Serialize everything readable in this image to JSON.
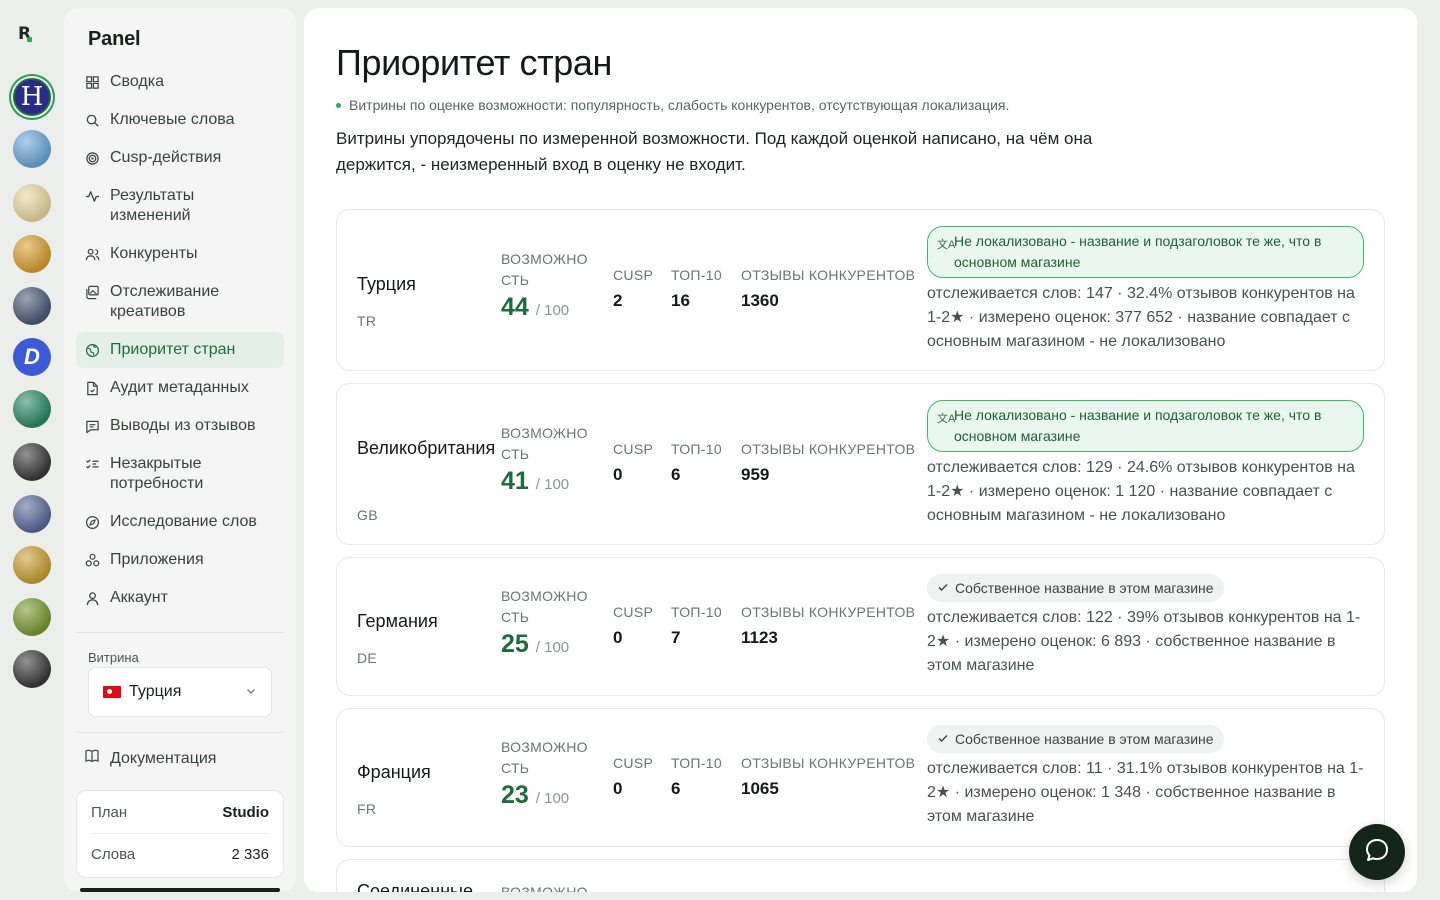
{
  "rail": {
    "apps": [
      {
        "name": "app-icon-h",
        "letter": "H",
        "bg": "#2a2a8a",
        "selected": true
      },
      {
        "name": "app-icon-runner",
        "letter": "",
        "bg": "#6aa8d8"
      },
      {
        "name": "app-icon-altin",
        "letter": "",
        "bg": "#e8d8a0"
      },
      {
        "name": "app-icon-blocks",
        "letter": "",
        "bg": "#d8a030"
      },
      {
        "name": "app-icon-chart",
        "letter": "",
        "bg": "#4a5a78"
      },
      {
        "name": "app-icon-d",
        "letter": "D",
        "bg": "#3a5ad8"
      },
      {
        "name": "app-icon-puzzle",
        "letter": "",
        "bg": "#2a8a6a"
      },
      {
        "name": "app-icon-investing",
        "letter": "",
        "bg": "#3a3a3a"
      },
      {
        "name": "app-icon-character",
        "letter": "",
        "bg": "#5a6a9a"
      },
      {
        "name": "app-icon-temple",
        "letter": "",
        "bg": "#c8a030"
      },
      {
        "name": "app-icon-temple-2",
        "letter": "",
        "bg": "#7a9a30"
      },
      {
        "name": "app-icon-tv",
        "letter": "",
        "bg": "#3a3a3a"
      }
    ]
  },
  "sidebar": {
    "brand": "Panel",
    "nav": [
      {
        "label": "Сводка",
        "icon": "grid-icon"
      },
      {
        "label": "Ключевые слова",
        "icon": "search-icon"
      },
      {
        "label": "Cusp-действия",
        "icon": "target-icon"
      },
      {
        "label": "Результаты изменений",
        "icon": "activity-icon"
      },
      {
        "label": "Конкуренты",
        "icon": "users-icon"
      },
      {
        "label": "Отслеживание креативов",
        "icon": "images-icon"
      },
      {
        "label": "Приоритет стран",
        "icon": "globe-icon",
        "active": true
      },
      {
        "label": "Аудит метаданных",
        "icon": "file-icon"
      },
      {
        "label": "Выводы из отзывов",
        "icon": "message-icon"
      },
      {
        "label": "Незакрытые потребности",
        "icon": "checklist-icon"
      },
      {
        "label": "Исследование слов",
        "icon": "compass-icon"
      },
      {
        "label": "Приложения",
        "icon": "apps-icon"
      },
      {
        "label": "Аккаунт",
        "icon": "user-icon"
      }
    ],
    "store_label": "Витрина",
    "store_value": "Турция",
    "docs_label": "Документация",
    "plan_label": "План",
    "plan_value": "Studio",
    "words_label": "Слова",
    "words_value": "2 336"
  },
  "main": {
    "title": "Приоритет стран",
    "subtitle": "Витрины по оценке возможности: популярность, слабость конкурентов, отсутствующая локализация.",
    "intro": "Витрины упорядочены по измеренной возможности. Под каждой оценкой написано, на чём она держится, - неизмеренный вход в оценку не входит.",
    "labels": {
      "opportunity": "ВОЗМОЖНОСТЬ",
      "cusp": "CUSP",
      "top10": "ТОП-10",
      "reviews": "ОТЗЫВЫ КОНКУРЕНТОВ",
      "out_of": "/ 100"
    },
    "cards": [
      {
        "country": "Турция",
        "code": "TR",
        "score": "44",
        "cusp": "2",
        "top10": "16",
        "reviews": "1360",
        "badge_type": "warn",
        "badge": "Не локализовано - название и подзаголовок те же, что в основном магазине",
        "detail": "отслеживается слов: 147 · 32.4% отзывов конкурентов на 1-2★ · измерено оценок: 377 652 · название совпадает с основным магазином - не локализовано"
      },
      {
        "country": "Великобритания",
        "code": "GB",
        "score": "41",
        "cusp": "0",
        "top10": "6",
        "reviews": "959",
        "badge_type": "warn",
        "badge": "Не локализовано - название и подзаголовок те же, что в основном магазине",
        "detail": "отслеживается слов: 129 · 24.6% отзывов конкурентов на 1-2★ · измерено оценок: 1 120 · название совпадает с основным магазином - не локализовано"
      },
      {
        "country": "Германия",
        "code": "DE",
        "score": "25",
        "cusp": "0",
        "top10": "7",
        "reviews": "1123",
        "badge_type": "ok",
        "badge": "Собственное название в этом магазине",
        "detail": "отслеживается слов: 122 · 39% отзывов конкурентов на 1-2★ · измерено оценок: 6 893 · собственное название в этом магазине"
      },
      {
        "country": "Франция",
        "code": "FR",
        "score": "23",
        "cusp": "0",
        "top10": "6",
        "reviews": "1065",
        "badge_type": "ok",
        "badge": "Собственное название в этом магазине",
        "detail": "отслеживается слов: 11 · 31.1% отзывов конкурентов на 1-2★ · измерено оценок: 1 348 · собственное название в этом магазине"
      },
      {
        "country": "Соединенные",
        "code": "",
        "score": "",
        "cusp": "",
        "top10": "",
        "reviews": "",
        "badge_type": "none",
        "badge": "",
        "detail": ""
      }
    ]
  },
  "colors": {
    "accent": "#1f6b3d",
    "badge_border": "#3fb86a",
    "badge_bg": "#eaf7ee",
    "fab": "#14261b"
  }
}
